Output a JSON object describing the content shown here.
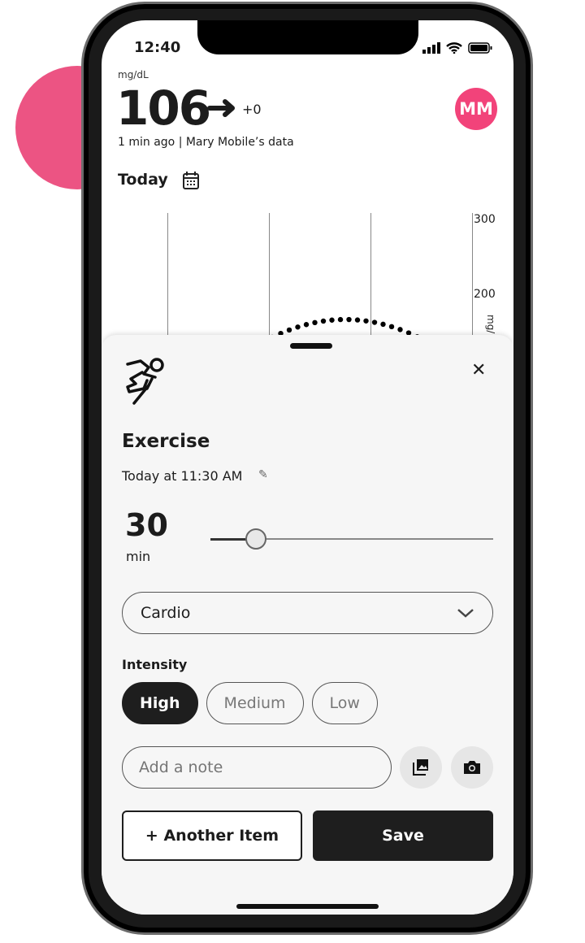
{
  "status_bar": {
    "time": "12:40"
  },
  "glucose": {
    "unit": "mg/dL",
    "value": "106",
    "trend": "steady-arrow-icon",
    "delta": "+0",
    "updated": "1 min ago | Mary Mobile’s data"
  },
  "avatar": {
    "initials": "MM",
    "color": "#f2437a"
  },
  "chart": {
    "period_label": "Today",
    "y_ticks": [
      "300",
      "200"
    ],
    "y_unit": "mg/"
  },
  "sheet": {
    "icon": "running-person-icon",
    "title": "Exercise",
    "datetime": "Today at 11:30 AM",
    "duration_value": "30",
    "duration_unit": "min",
    "slider_fraction": 0.16,
    "type_selected": "Cardio",
    "intensity_label": "Intensity",
    "intensity_options": [
      "High",
      "Medium",
      "Low"
    ],
    "intensity_selected": "High",
    "note_placeholder": "Add a note",
    "another_label": "+ Another Item",
    "save_label": "Save"
  },
  "colors": {
    "accent_blob": "#ec5483",
    "primary": "#1e1e1e"
  }
}
